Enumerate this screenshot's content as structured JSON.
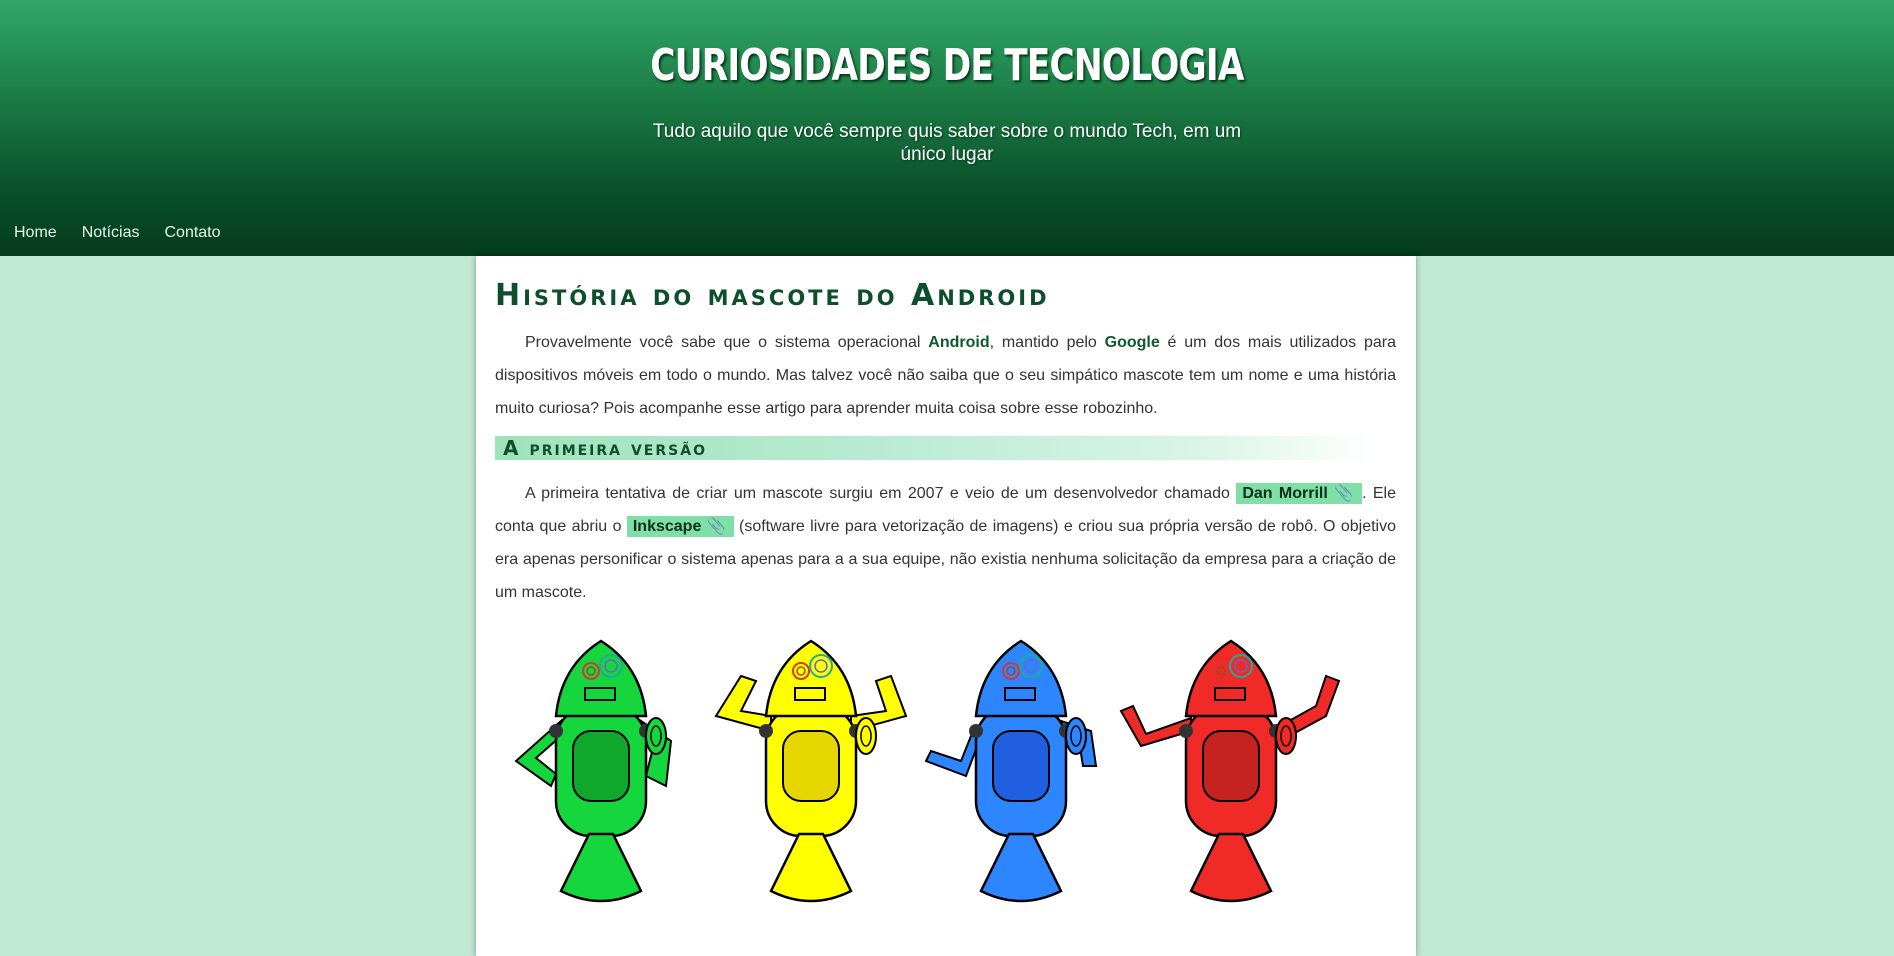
{
  "header": {
    "title": "CURIOSIDADES DE TECNOLOGIA",
    "subtitle": "Tudo aquilo que você sempre quis saber sobre o mundo Tech, em um único lugar"
  },
  "nav": {
    "items": [
      "Home",
      "Notícias",
      "Contato"
    ]
  },
  "article": {
    "title": "História do mascote do Android",
    "intro": {
      "p1": "Provavelmente você sabe que o sistema operacional ",
      "kw1": "Android",
      "p2": ", mantido pelo ",
      "kw2": "Google",
      "p3": " é um dos mais utilizados para dispositivos móveis em todo o mundo. Mas talvez você não saiba que o seu simpático mascote tem um nome e uma história muito curiosa? Pois acompanhe esse artigo para aprender muita coisa sobre esse robozinho."
    },
    "section1": {
      "title": "A primeira versão",
      "p1": "A primeira tentativa de criar um mascote surgiu em 2007 e veio de um desenvolvedor chamado ",
      "link1": "Dan Morrill",
      "p2": ". Ele conta que abriu o ",
      "link2": "Inkscape",
      "p3": " (software livre para vetorização de imagens) e criou sua própria versão de robô. O objetivo era apenas personificar o sistema apenas para a a sua equipe, não existia nenhuma solicitação da empresa para a criação de um mascote.",
      "link_icon": "📎"
    },
    "robots": [
      {
        "name": "green-robot",
        "color": "#16d63e",
        "dark": "#0fa82c"
      },
      {
        "name": "yellow-robot",
        "color": "#ffff00",
        "dark": "#e6d600"
      },
      {
        "name": "blue-robot",
        "color": "#2e86ff",
        "dark": "#1f5fe0"
      },
      {
        "name": "red-robot",
        "color": "#f02a26",
        "dark": "#c42320"
      }
    ]
  }
}
